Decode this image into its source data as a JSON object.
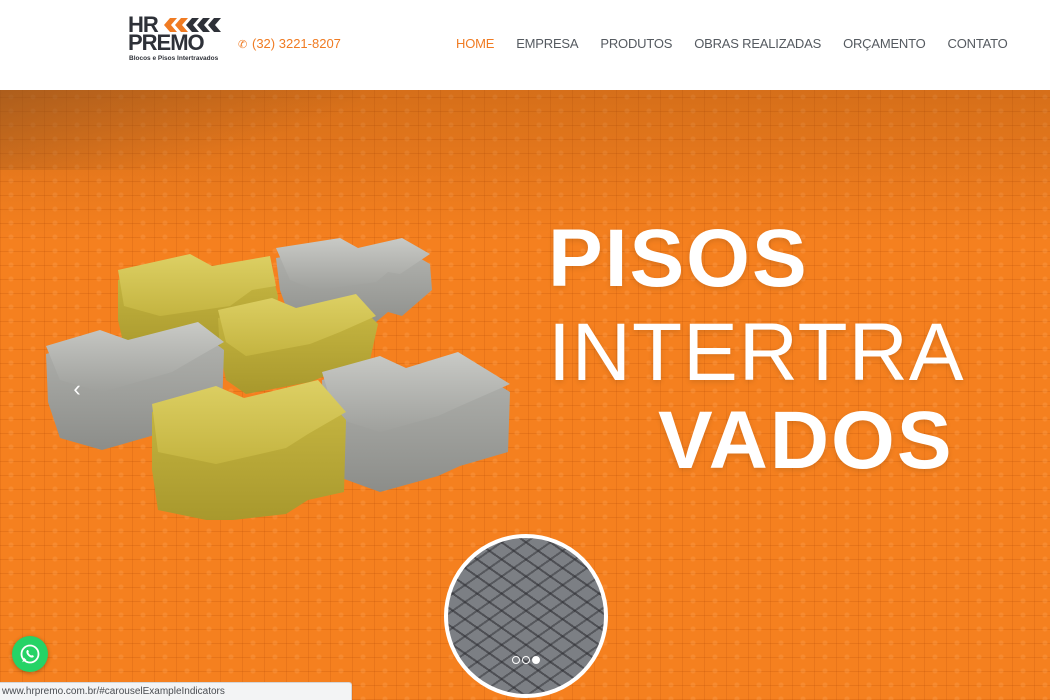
{
  "brand": {
    "logo_line1": "HR",
    "logo_line2": "PREMO",
    "tagline": "Blocos e Pisos Intertravados",
    "accent_color": "#f07b22",
    "dark_color": "#2e3138"
  },
  "header": {
    "phone": "(32) 3221-8207",
    "phone_icon": "phone-icon"
  },
  "nav": {
    "items": [
      {
        "label": "HOME",
        "active": true
      },
      {
        "label": "EMPRESA",
        "active": false
      },
      {
        "label": "PRODUTOS",
        "active": false
      },
      {
        "label": "OBRAS REALIZADAS",
        "active": false
      },
      {
        "label": "ORÇAMENTO",
        "active": false
      },
      {
        "label": "CONTATO",
        "active": false
      }
    ]
  },
  "hero": {
    "title_line1": "PISOS",
    "title_line2": "INTERTRA",
    "title_line3": "VADOS",
    "background_color": "#f5801f",
    "prev_icon": "chevron-left-icon",
    "indicators": [
      {
        "active": false
      },
      {
        "active": false
      },
      {
        "active": true
      }
    ]
  },
  "floating": {
    "whatsapp_icon": "whatsapp-icon",
    "whatsapp_color": "#25d366"
  },
  "statusbar": {
    "url": "www.hrpremo.com.br/#carouselExampleIndicators"
  }
}
